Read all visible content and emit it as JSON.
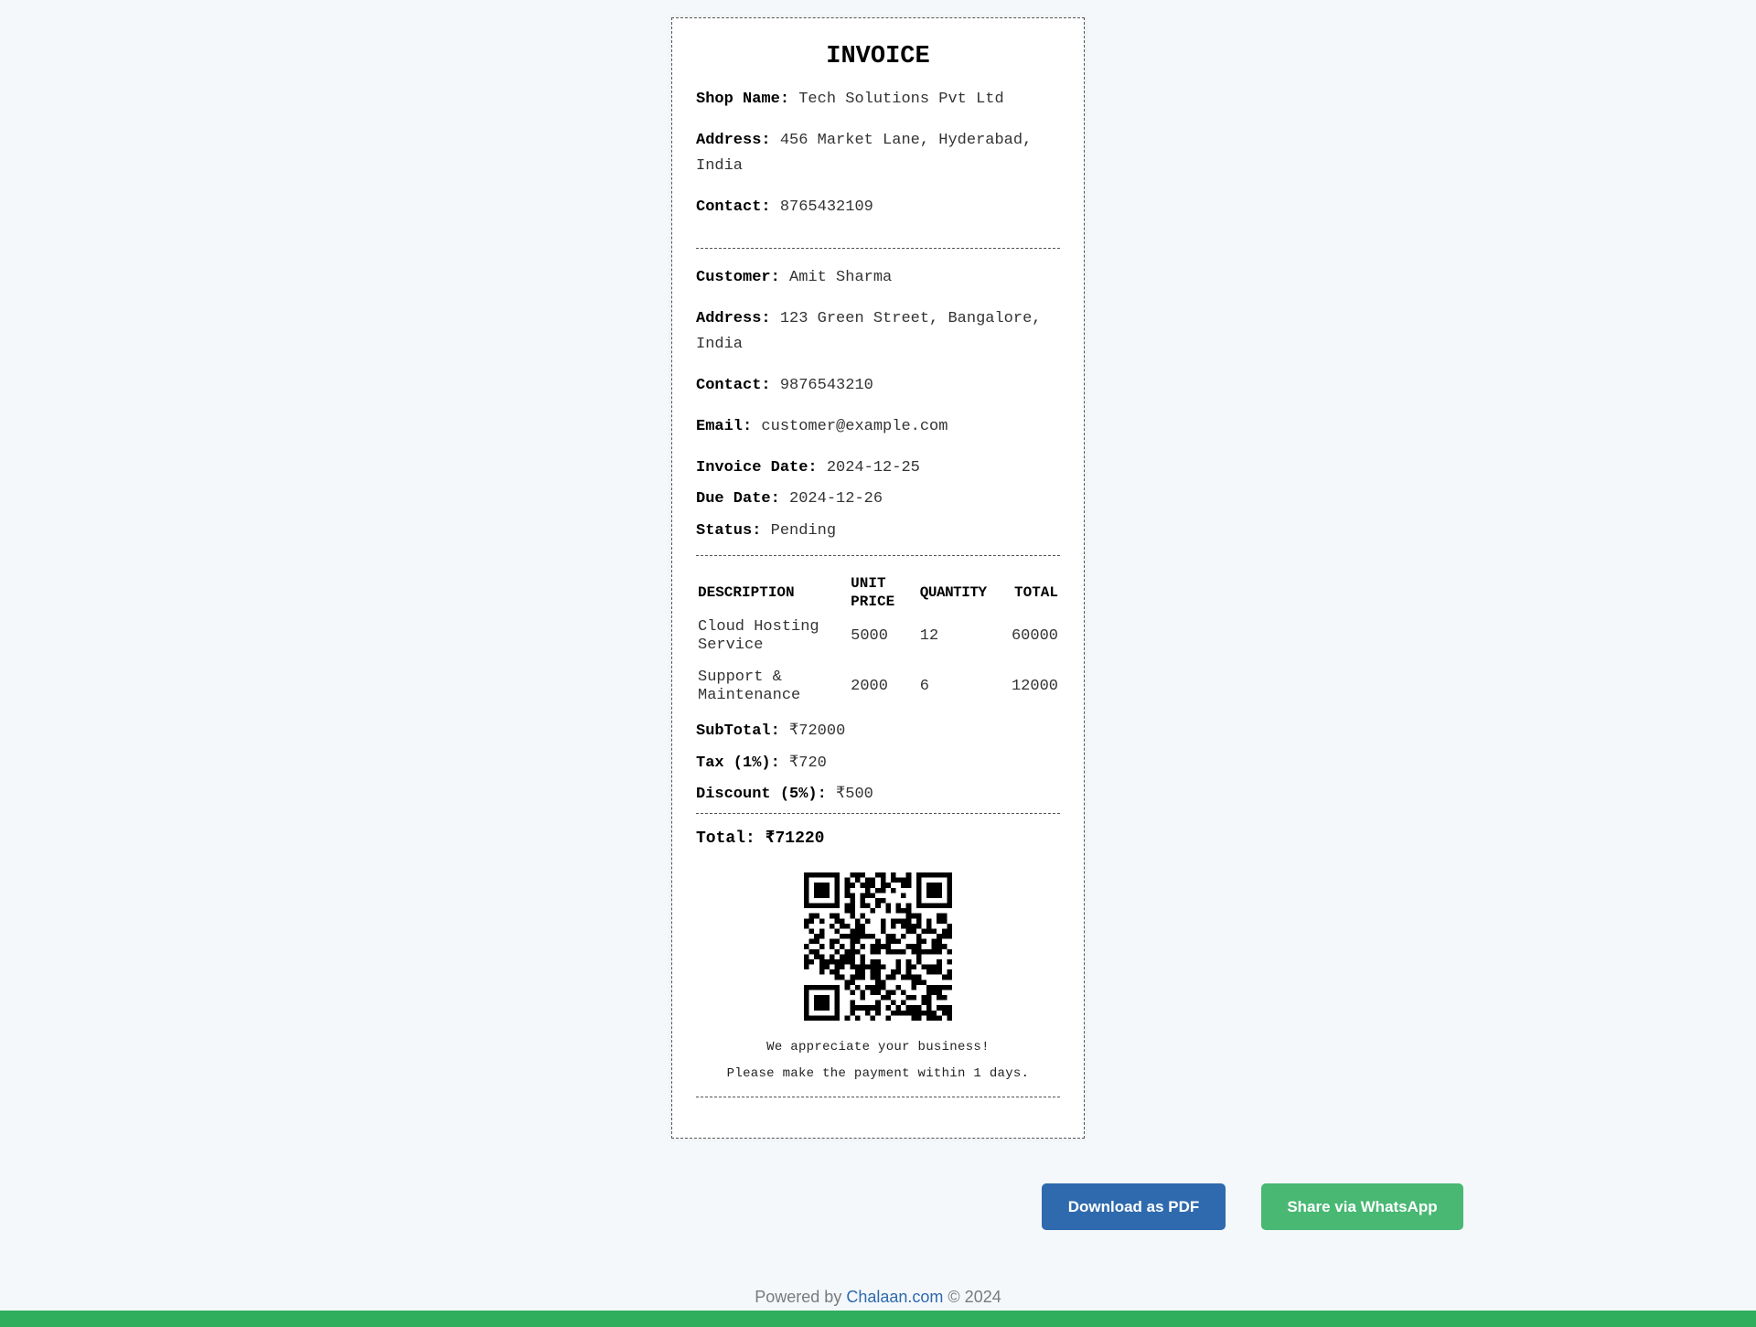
{
  "invoice": {
    "title": "INVOICE",
    "shop": {
      "name_label": "Shop Name:",
      "name": "Tech Solutions Pvt Ltd",
      "address_label": "Address:",
      "address": "456 Market Lane, Hyderabad, India",
      "contact_label": "Contact:",
      "contact": "8765432109"
    },
    "customer": {
      "name_label": "Customer:",
      "name": "Amit Sharma",
      "address_label": "Address:",
      "address": "123 Green Street, Bangalore, India",
      "contact_label": "Contact:",
      "contact": "9876543210",
      "email_label": "Email:",
      "email": "customer@example.com"
    },
    "dates": {
      "invoice_date_label": "Invoice Date:",
      "invoice_date": "2024-12-25",
      "due_date_label": "Due Date:",
      "due_date": "2024-12-26",
      "status_label": "Status:",
      "status": "Pending"
    },
    "table": {
      "headers": {
        "description": "DESCRIPTION",
        "unit_price_line1": "UNIT",
        "unit_price_line2": "PRICE",
        "quantity": "QUANTITY",
        "total": "TOTAL"
      },
      "rows": [
        {
          "description_line1": "Cloud Hosting",
          "description_line2": "Service",
          "unit_price": "5000",
          "quantity": "12",
          "total": "60000"
        },
        {
          "description_line1": "Support &",
          "description_line2": "Maintenance",
          "unit_price": "2000",
          "quantity": "6",
          "total": "12000"
        }
      ]
    },
    "summary": {
      "subtotal_label": "SubTotal:",
      "subtotal": "₹72000",
      "tax_label": "Tax (1%):",
      "tax": "₹720",
      "discount_label": "Discount (5%):",
      "discount": "₹500",
      "total_label": "Total:",
      "total": "₹71220"
    },
    "qr_icon": "qr-code",
    "thanks": "We appreciate your business!",
    "payment_note": "Please make the payment within 1 days."
  },
  "actions": {
    "download_pdf": "Download as PDF",
    "share_whatsapp": "Share via WhatsApp"
  },
  "footer": {
    "powered_prefix": "Powered by",
    "brand": "Chalaan.com",
    "suffix": "© 2024"
  },
  "colors": {
    "pdf_button": "#2e6aad",
    "whatsapp_button": "#48b873",
    "bottom_bar": "#2fae5e",
    "page_background": "#f5f8fb"
  }
}
